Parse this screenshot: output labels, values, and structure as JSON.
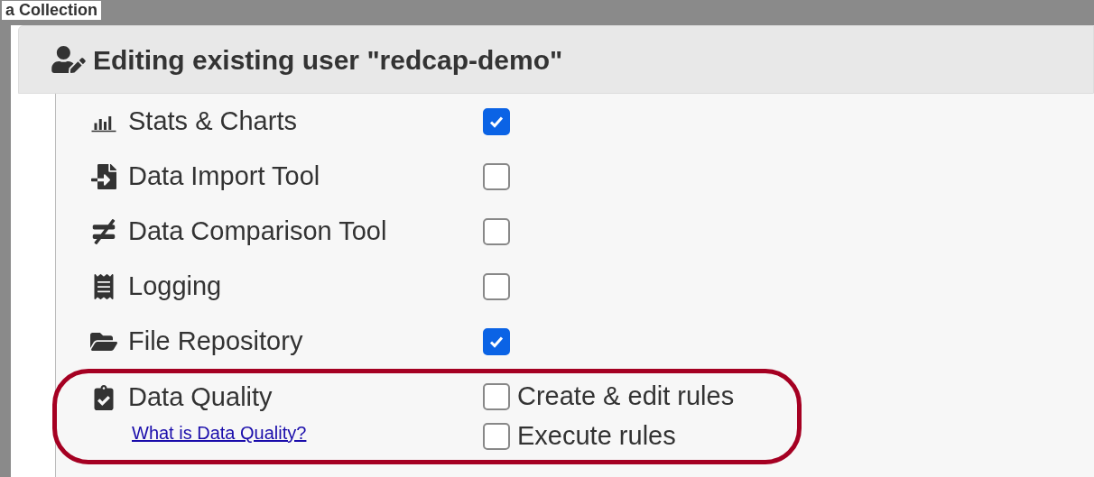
{
  "background": {
    "title": "a Collection"
  },
  "dialog": {
    "title": "Editing existing user \"redcap-demo\"",
    "rows": [
      {
        "kind": "single",
        "label": "Stats & Charts",
        "checked": true
      },
      {
        "kind": "single",
        "label": "Data Import Tool",
        "checked": false
      },
      {
        "kind": "single",
        "label": "Data Comparison Tool",
        "checked": false
      },
      {
        "kind": "single",
        "label": "Logging",
        "checked": false
      },
      {
        "kind": "single",
        "label": "File Repository",
        "checked": true
      },
      {
        "kind": "multi",
        "label": "Data Quality",
        "link": "What is Data Quality?",
        "highlighted": true,
        "options": [
          {
            "label": "Create & edit rules",
            "checked": false
          },
          {
            "label": "Execute rules",
            "checked": false
          }
        ]
      }
    ]
  }
}
